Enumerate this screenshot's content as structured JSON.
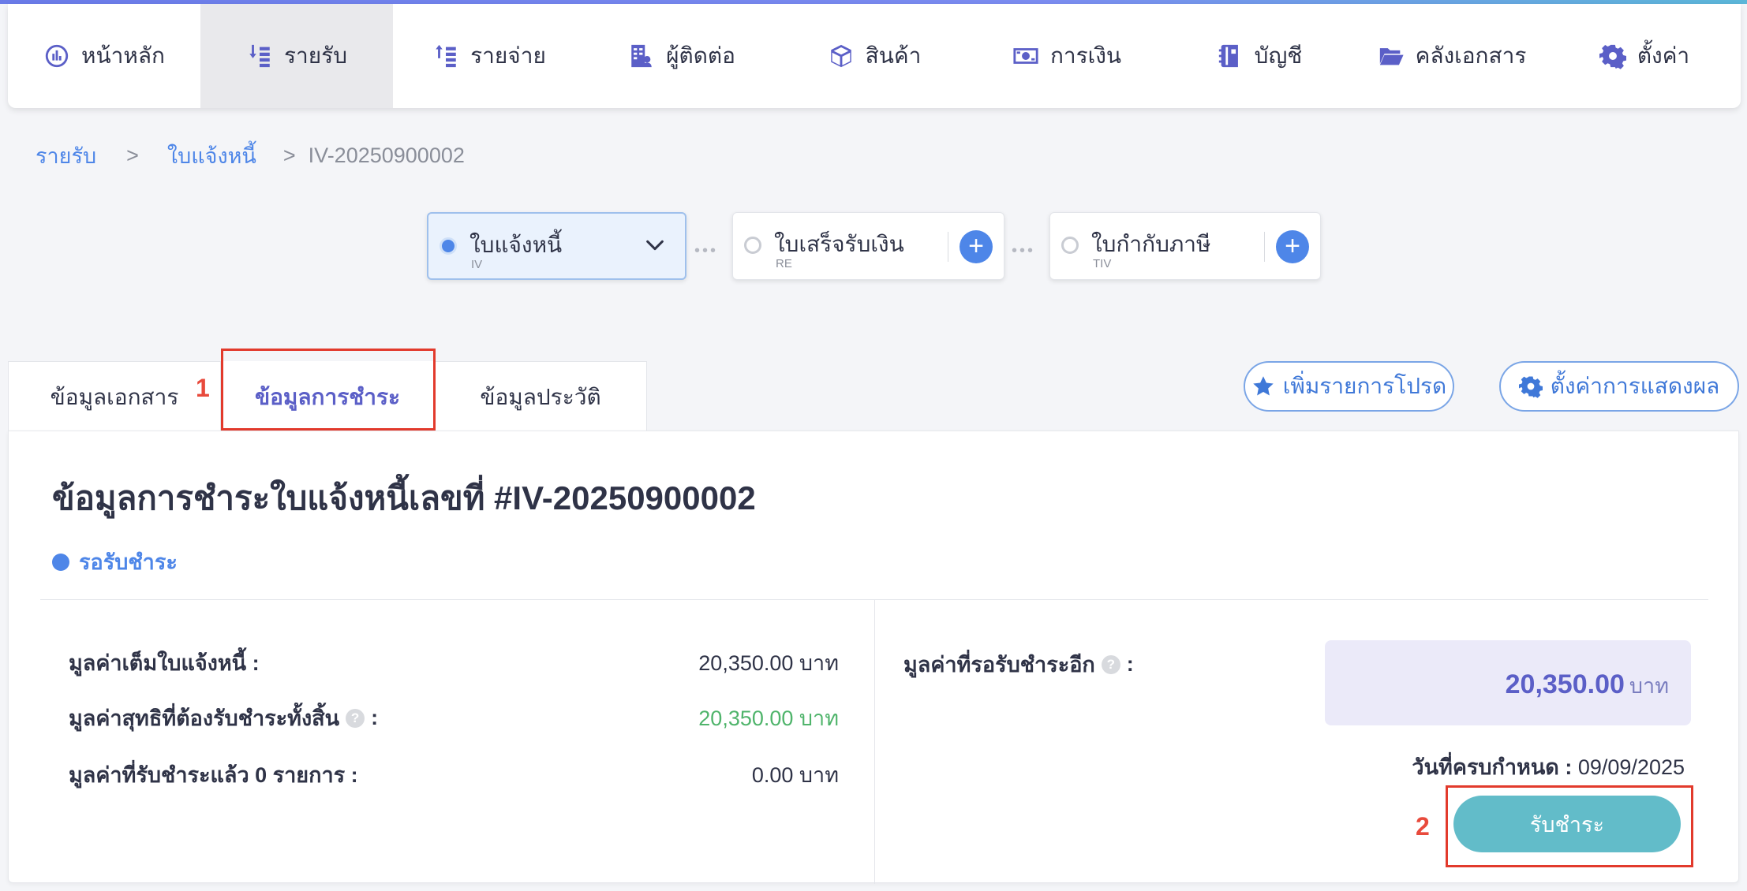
{
  "nav": {
    "items": [
      {
        "label": "หน้าหลัก",
        "icon": "dashboard-icon"
      },
      {
        "label": "รายรับ",
        "icon": "income-icon"
      },
      {
        "label": "รายจ่าย",
        "icon": "expense-icon"
      },
      {
        "label": "ผู้ติดต่อ",
        "icon": "contacts-icon"
      },
      {
        "label": "สินค้า",
        "icon": "box-icon"
      },
      {
        "label": "การเงิน",
        "icon": "money-icon"
      },
      {
        "label": "บัญชี",
        "icon": "ledger-icon"
      },
      {
        "label": "คลังเอกสาร",
        "icon": "folder-icon"
      },
      {
        "label": "ตั้งค่า",
        "icon": "gear-icon"
      }
    ],
    "active_index": 1
  },
  "breadcrumb": {
    "level1": "รายรับ",
    "separator": ">",
    "level2": "ใบแจ้งหนี้",
    "current": "IV-20250900002"
  },
  "flow": {
    "steps": [
      {
        "title": "ใบแจ้งหนี้",
        "code": "IV"
      },
      {
        "title": "ใบเสร็จรับเงิน",
        "code": "RE",
        "action": "+"
      },
      {
        "title": "ใบกำกับภาษี",
        "code": "TIV",
        "action": "+"
      }
    ],
    "connector": "•••"
  },
  "tabs": {
    "document": "ข้อมูลเอกสาร",
    "payment": "ข้อมูลการชำระ",
    "history": "ข้อมูลประวัติ",
    "step1_marker": "1"
  },
  "actions": {
    "favorite": "เพิ่มรายการโปรด",
    "display_settings": "ตั้งค่าการแสดงผล"
  },
  "panel": {
    "title": "ข้อมูลการชำระใบแจ้งหนี้เลขที่ #IV-20250900002",
    "status": "รอรับชำระ",
    "rows": [
      {
        "label": "มูลค่าเต็มใบแจ้งหนี้ :",
        "value": "20,350.00 บาท"
      },
      {
        "label": "มูลค่าสุทธิที่ต้องรับชำระทั้งสิ้น",
        "suffix": ":",
        "value": "20,350.00 บาท"
      },
      {
        "label": "มูลค่าที่รับชำระแล้ว 0 รายการ :",
        "value": "0.00 บาท"
      }
    ],
    "help_glyph": "?",
    "remaining_label": "มูลค่าที่รอรับชำระอีก",
    "remaining_suffix": ":",
    "remaining_amount": "20,350.00",
    "remaining_unit": "บาท",
    "due_label": "วันที่ครบกำหนด :",
    "due_date": "09/09/2025",
    "pay_button": "รับชำระ",
    "step2_marker": "2"
  },
  "colors": {
    "accent": "#5b5fc7",
    "link": "#4e86e8",
    "green": "#4fb46b",
    "pay_button": "#62bcc9",
    "highlight_box": "#e23a2c"
  }
}
